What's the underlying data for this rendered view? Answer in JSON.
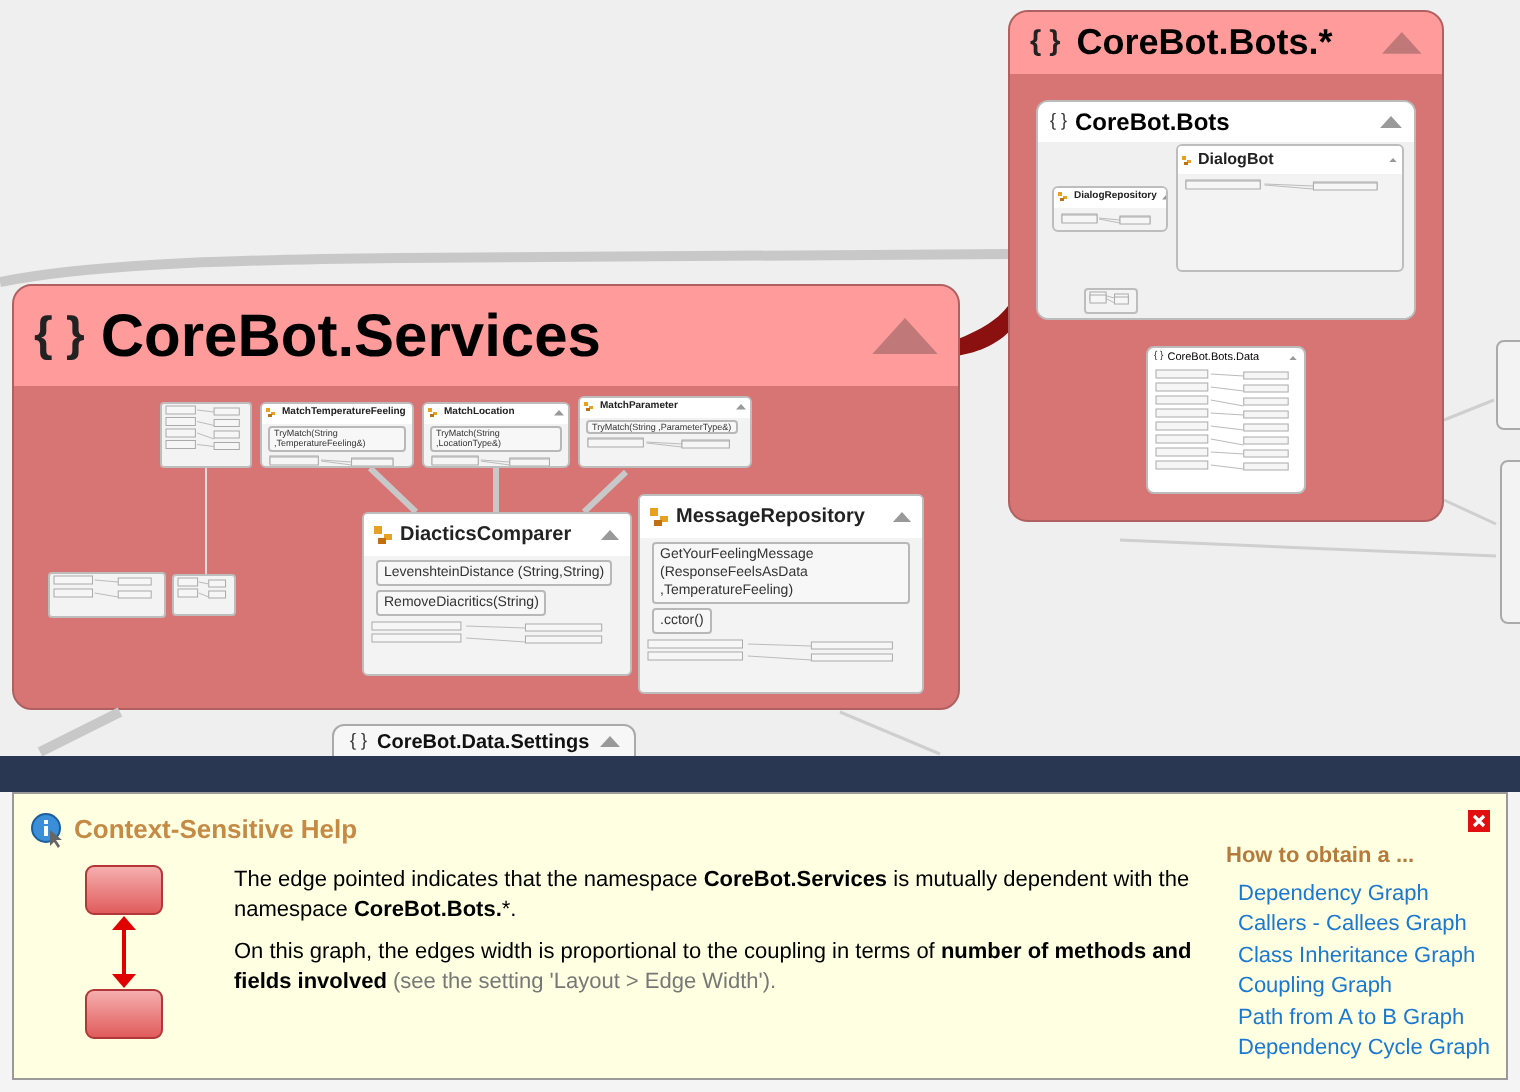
{
  "graph": {
    "namespaces": [
      {
        "title": "CoreBot.Services",
        "brace": "{ }",
        "classes": [
          {
            "name": "MatchTemperatureFeeling",
            "members": [
              "TryMatch(String ,TemperatureFeeling&)"
            ]
          },
          {
            "name": "MatchLocation",
            "members": [
              "TryMatch(String ,LocationType&)"
            ]
          },
          {
            "name": "MatchParameter",
            "members": [
              "TryMatch(String ,ParameterType&)"
            ]
          },
          {
            "name": "DiacticsComparer",
            "members": [
              "LevenshteinDistance (String,String)",
              "RemoveDiacritics(String)"
            ]
          },
          {
            "name": "MessageRepository",
            "members": [
              "GetYourFeelingMessage (ResponseFeelsAsData ,TemperatureFeeling)",
              ".cctor()"
            ]
          }
        ]
      },
      {
        "title": "CoreBot.Bots.*",
        "brace": "{ }",
        "children": [
          {
            "title": "CoreBot.Bots",
            "brace": "{ }",
            "classes": [
              {
                "name": "DialogBot"
              },
              {
                "name": "DialogRepository"
              }
            ]
          },
          {
            "title": "CoreBot.Bots.Data",
            "brace": "{ }"
          }
        ]
      },
      {
        "title": "CoreBot.Data.Settings",
        "brace": "{ }"
      }
    ]
  },
  "help": {
    "title": "Context-Sensitive Help",
    "paragraphs": [
      "The edge pointed indicates that the namespace **CoreBot.Services** is mutually dependent with the namespace **CoreBot.Bots.***."
    ],
    "coupling": {
      "text": "On this graph, the edges width is proportional to the coupling in terms of **number of methods and fields involved**",
      "note": "(see the setting 'Layout > Edge Width')."
    },
    "how_to": {
      "title": "How to obtain a ...",
      "links": [
        "Dependency Graph",
        "Callers - Callees Graph",
        "Class Inheritance Graph",
        "Coupling Graph",
        "Path from A to B Graph",
        "Dependency Cycle Graph"
      ]
    }
  }
}
